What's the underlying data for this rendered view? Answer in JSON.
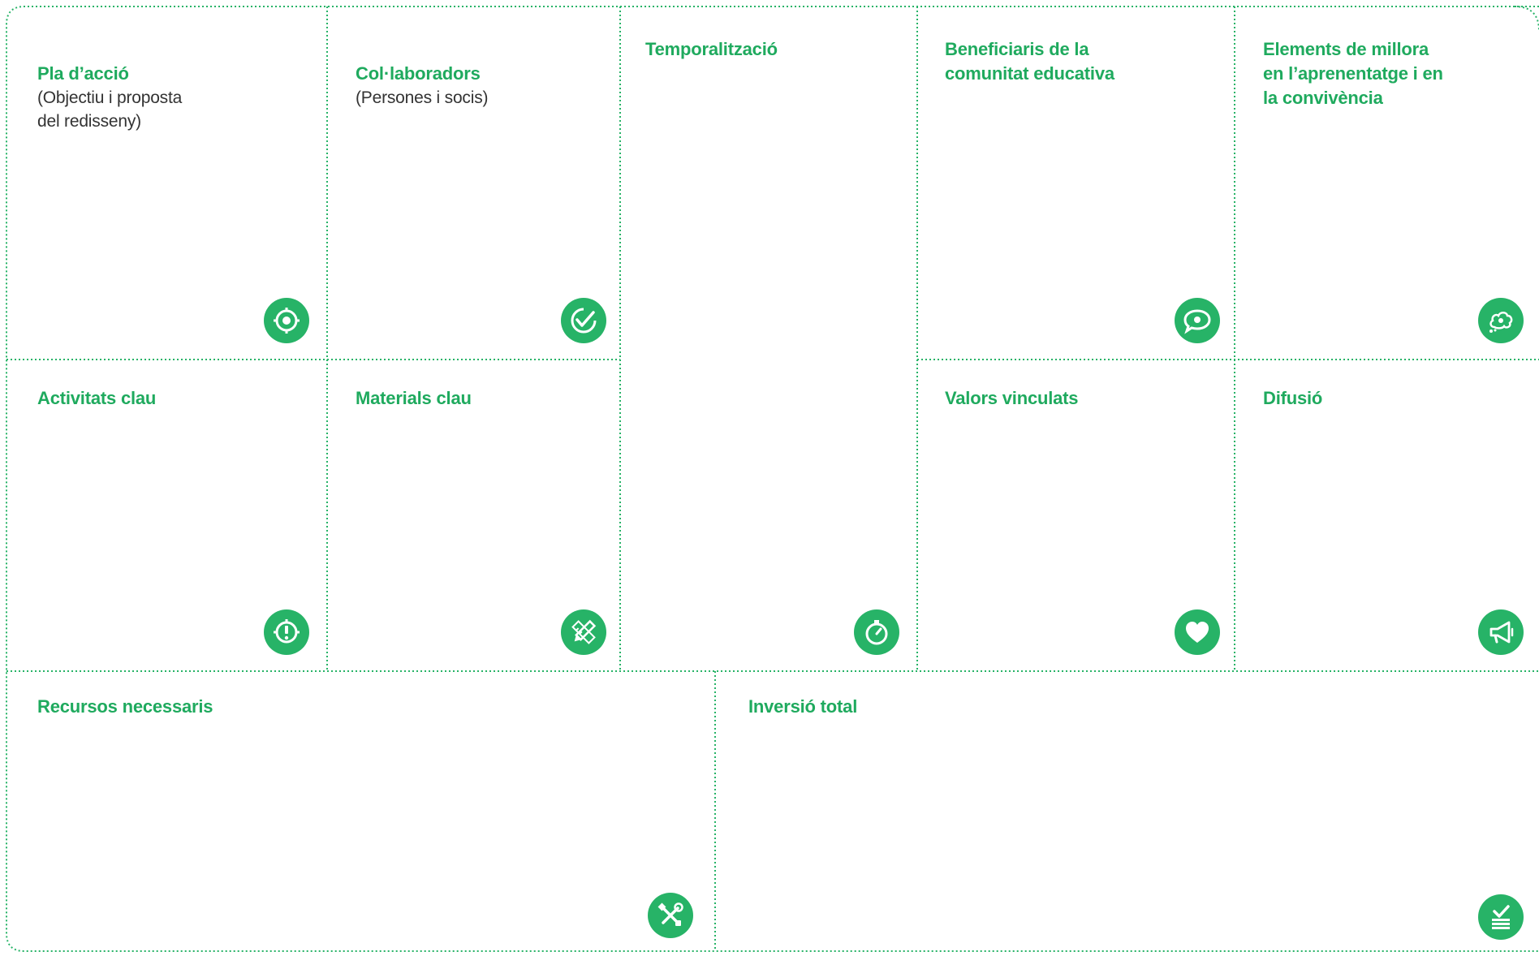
{
  "colors": {
    "accent": "#27b367",
    "title": "#1faa5e",
    "text": "#333333",
    "border": "#27b367"
  },
  "cells": {
    "pla": {
      "title": "Pla d’acció",
      "subtitle": "(Objectiu i proposta\ndel redisseny)",
      "icon": "target-icon"
    },
    "collaboradors": {
      "title": "Col·laboradors",
      "subtitle": "(Persones i socis)",
      "icon": "check-badge-icon"
    },
    "temporalitzacio": {
      "title": "Temporalització",
      "icon": "stopwatch-icon"
    },
    "beneficiaris": {
      "title": "Beneficiaris de la\ncomunitat educativa",
      "icon": "speech-eye-icon"
    },
    "elements": {
      "title": "Elements de millora\nen l’aprenentatge i en\nla convivència",
      "icon": "thought-bubble-icon"
    },
    "activitats": {
      "title": "Activitats clau",
      "icon": "alert-target-icon"
    },
    "materials": {
      "title": "Materials clau",
      "icon": "pencil-ruler-icon"
    },
    "valors": {
      "title": "Valors vinculats",
      "icon": "heart-icon"
    },
    "difusio": {
      "title": "Difusió",
      "icon": "megaphone-icon"
    },
    "recursos": {
      "title": "Recursos necessaris",
      "icon": "tools-icon"
    },
    "inversio": {
      "title": "Inversió total",
      "icon": "checklist-icon"
    }
  }
}
